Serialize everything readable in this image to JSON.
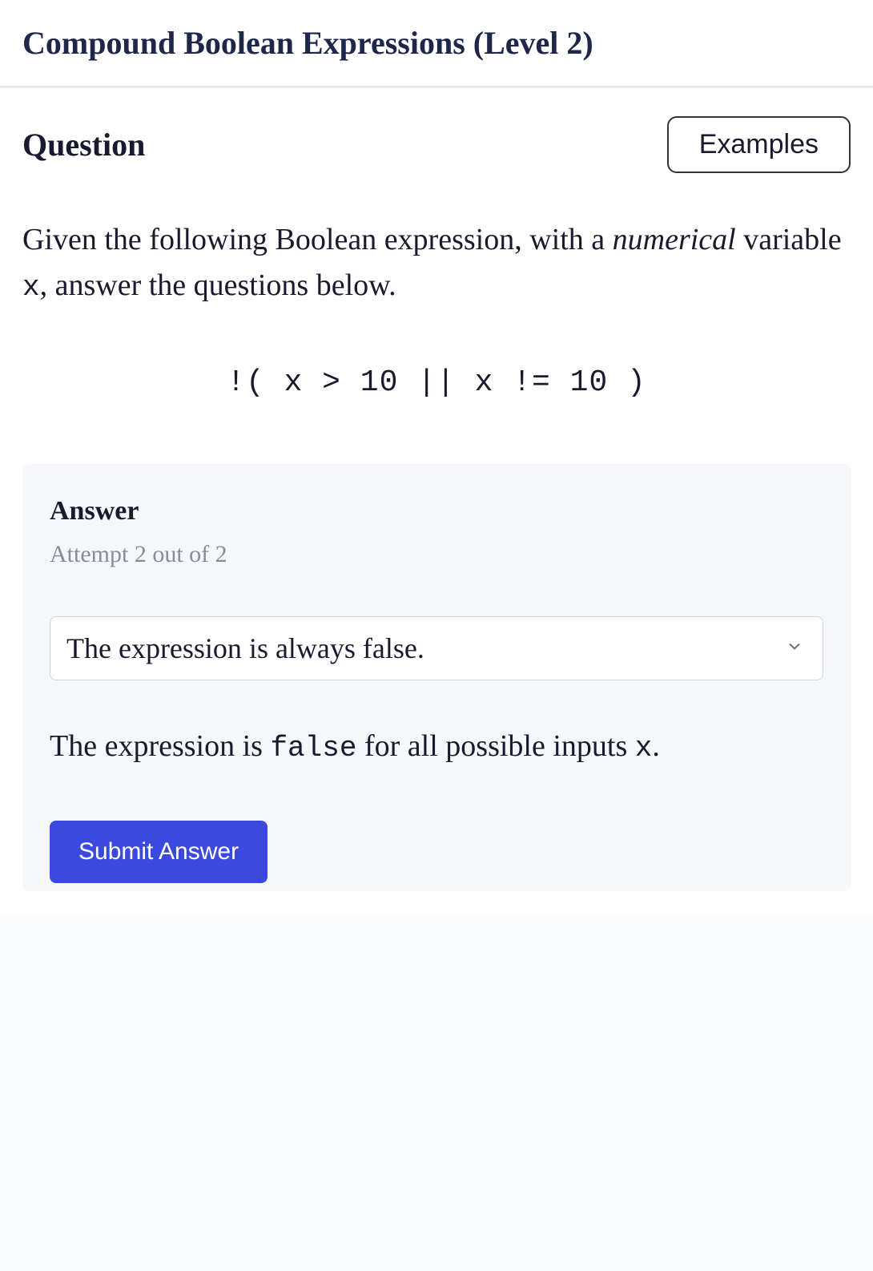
{
  "header": {
    "title": "Compound Boolean Expressions (Level 2)"
  },
  "question": {
    "heading": "Question",
    "examples_label": "Examples",
    "prompt_pre": "Given the following Boolean expression, with a ",
    "prompt_italic": "numerical",
    "prompt_mid": " variable ",
    "prompt_var": "x",
    "prompt_post": ", answer the questions below.",
    "code": "!( x > 10 || x != 10 )"
  },
  "answer": {
    "heading": "Answer",
    "attempt": "Attempt 2 out of 2",
    "selected": "The expression is always false.",
    "explanation_pre": "The expression is ",
    "explanation_code": "false",
    "explanation_mid": " for all possible inputs ",
    "explanation_var": "x",
    "explanation_post": ".",
    "submit_label": "Submit Answer"
  }
}
